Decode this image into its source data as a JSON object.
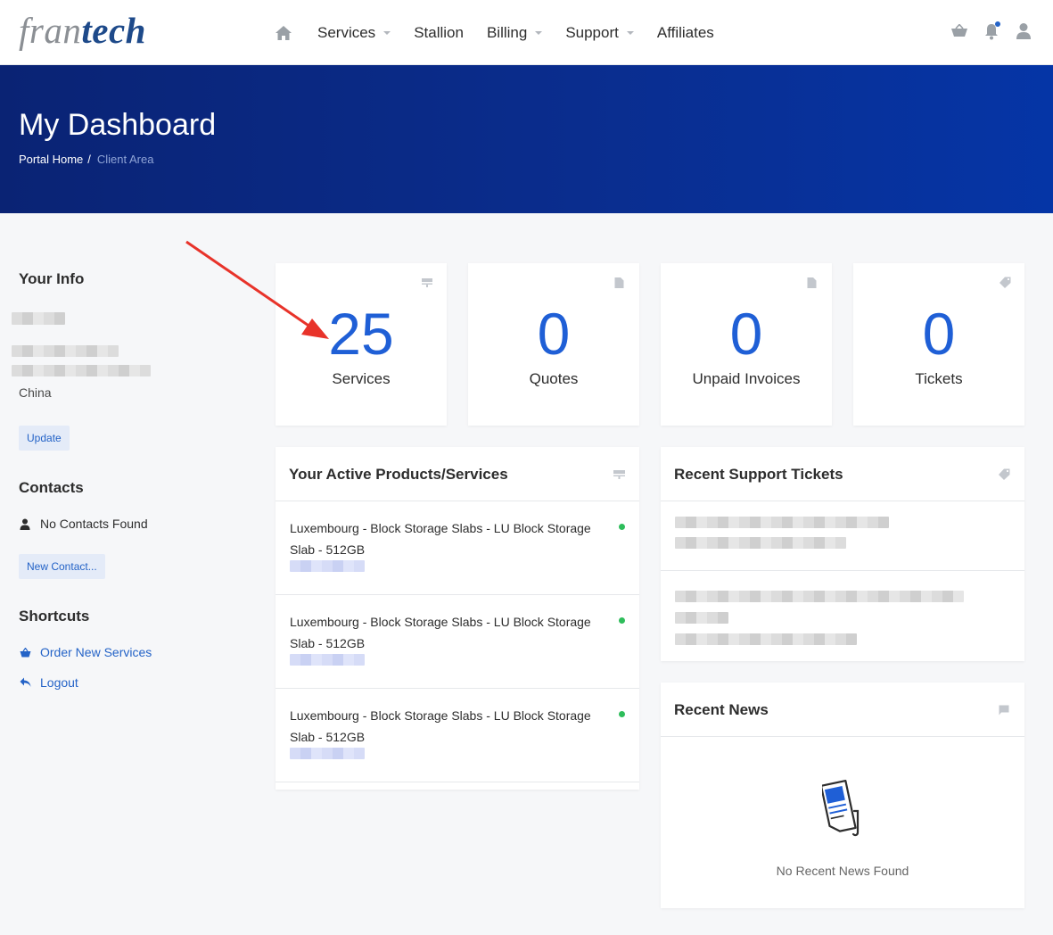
{
  "brand": {
    "part1": "fran",
    "part2": "tech"
  },
  "nav": {
    "items": [
      {
        "label": "Services",
        "dropdown": true
      },
      {
        "label": "Stallion",
        "dropdown": false
      },
      {
        "label": "Billing",
        "dropdown": true
      },
      {
        "label": "Support",
        "dropdown": true
      },
      {
        "label": "Affiliates",
        "dropdown": false
      }
    ]
  },
  "banner": {
    "title": "My Dashboard",
    "breadcrumb": {
      "home": "Portal Home",
      "current": "Client Area"
    }
  },
  "sidebar": {
    "your_info": {
      "title": "Your Info",
      "country": "China",
      "update_label": "Update"
    },
    "contacts": {
      "title": "Contacts",
      "empty": "No Contacts Found",
      "new_label": "New Contact..."
    },
    "shortcuts": {
      "title": "Shortcuts",
      "items": [
        {
          "label": "Order New Services",
          "icon": "basket-icon"
        },
        {
          "label": "Logout",
          "icon": "logout-icon"
        }
      ]
    }
  },
  "stats": [
    {
      "value": "25",
      "label": "Services",
      "icon": "server-icon"
    },
    {
      "value": "0",
      "label": "Quotes",
      "icon": "document-icon"
    },
    {
      "value": "0",
      "label": "Unpaid Invoices",
      "icon": "document-icon"
    },
    {
      "value": "0",
      "label": "Tickets",
      "icon": "tag-icon"
    }
  ],
  "products": {
    "title": "Your Active Products/Services",
    "items": [
      {
        "name": "Luxembourg - Block Storage Slabs - LU Block Storage Slab - 512GB",
        "status_color": "#2ebd5b"
      },
      {
        "name": "Luxembourg - Block Storage Slabs - LU Block Storage Slab - 512GB",
        "status_color": "#2ebd5b"
      },
      {
        "name": "Luxembourg - Block Storage Slabs - LU Block Storage Slab - 512GB",
        "status_color": "#2ebd5b"
      }
    ]
  },
  "tickets": {
    "title": "Recent Support Tickets"
  },
  "news": {
    "title": "Recent News",
    "empty": "No Recent News Found"
  },
  "colors": {
    "accent": "#1f5fd6",
    "banner": "#0a2d8e",
    "active": "#2ebd5b",
    "annotation": "#e8332a"
  }
}
